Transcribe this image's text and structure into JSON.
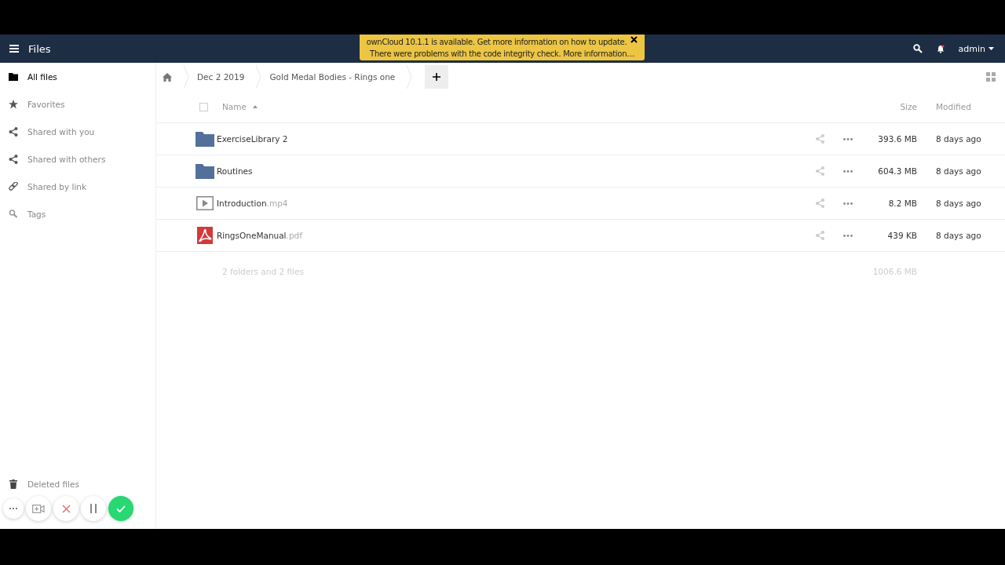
{
  "header": {
    "app_title": "Files",
    "user": "admin"
  },
  "notification": {
    "lines": [
      "ownCloud 10.1.1 is available. Get more information on how to update.",
      "There were problems with the code integrity check. More information…"
    ]
  },
  "sidebar": {
    "items": [
      {
        "label": "All files",
        "kind": "folder",
        "selected": true
      },
      {
        "label": "Favorites",
        "kind": "star",
        "selected": false
      },
      {
        "label": "Shared with you",
        "kind": "share",
        "selected": false
      },
      {
        "label": "Shared with others",
        "kind": "share",
        "selected": false
      },
      {
        "label": "Shared by link",
        "kind": "link",
        "selected": false
      },
      {
        "label": "Tags",
        "kind": "search",
        "selected": false
      }
    ],
    "footer_items": [
      {
        "label": "Deleted files",
        "kind": "trash"
      }
    ]
  },
  "breadcrumbs": [
    "Dec 2 2019",
    "Gold Medal Bodies - Rings one"
  ],
  "table": {
    "select_all_checked": false,
    "columns": [
      "Name",
      "Size",
      "Modified"
    ],
    "rows": [
      {
        "kind": "folder",
        "name": "ExerciseLibrary 2",
        "size": "393.6 MB",
        "modified": "8 days ago"
      },
      {
        "kind": "folder",
        "name": "Routines",
        "size": "604.3 MB",
        "modified": "8 days ago"
      },
      {
        "kind": "video",
        "name": "Introduction",
        "extension": ".mp4",
        "size": "8.2 MB",
        "modified": "8 days ago"
      },
      {
        "kind": "pdf",
        "name": "RingsOneManual",
        "extension": ".pdf",
        "size": "439 KB",
        "modified": "8 days ago"
      }
    ],
    "summary": {
      "count": "2 folders and 2 files",
      "size": "1006.6 MB"
    }
  },
  "recorder_controls": [
    {
      "kind": "more"
    },
    {
      "kind": "camera"
    },
    {
      "kind": "cancel"
    },
    {
      "kind": "pause"
    },
    {
      "kind": "done"
    }
  ]
}
